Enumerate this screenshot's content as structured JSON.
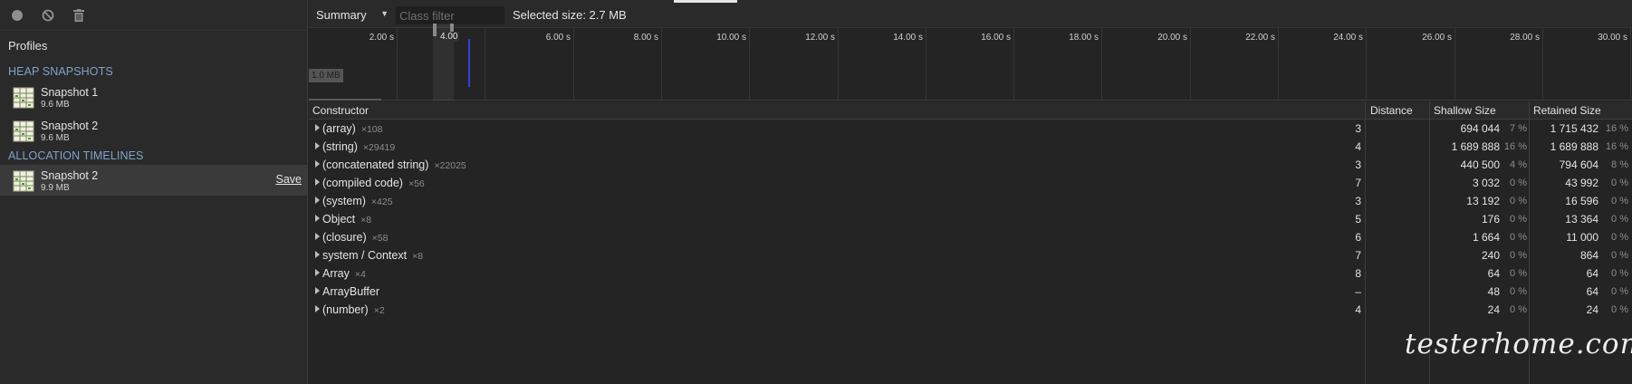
{
  "sidebar": {
    "toolbar": [
      {
        "icon": "record-icon"
      },
      {
        "icon": "clear-icon"
      },
      {
        "icon": "trash-icon"
      }
    ],
    "profiles_title": "Profiles",
    "heap_section_title": "HEAP SNAPSHOTS",
    "heap_snapshots": [
      {
        "name": "Snapshot 1",
        "size": "9.6 MB"
      },
      {
        "name": "Snapshot 2",
        "size": "9.6 MB"
      }
    ],
    "alloc_section_title": "ALLOCATION TIMELINES",
    "alloc_timelines": [
      {
        "name": "Snapshot 2",
        "size": "9.9 MB",
        "save_label": "Save",
        "selected": true
      }
    ]
  },
  "topbar": {
    "view": "Summary",
    "filter_placeholder": "Class filter",
    "filter_value": "",
    "selected_size": "Selected size: 2.7 MB"
  },
  "timeline": {
    "ticks": [
      "2.00 s",
      "4.00 s",
      "6.00 s",
      "8.00 s",
      "10.00 s",
      "12.00 s",
      "14.00 s",
      "16.00 s",
      "18.00 s",
      "20.00 s",
      "22.00 s",
      "24.00 s",
      "26.00 s",
      "28.00 s",
      "30.00 s"
    ],
    "memory_label": "1.0 MB",
    "window_label": "4.00"
  },
  "grid": {
    "headers": {
      "constructor": "Constructor",
      "distance": "Distance",
      "shallow": "Shallow Size",
      "retained": "Retained Size"
    },
    "rows": [
      {
        "name": "(array)",
        "count": "×108",
        "distance": "3",
        "shallow": "694 044",
        "shallow_pct": "7 %",
        "retained": "1 715 432",
        "retained_pct": "16 %"
      },
      {
        "name": "(string)",
        "count": "×29419",
        "distance": "4",
        "shallow": "1 689 888",
        "shallow_pct": "16 %",
        "retained": "1 689 888",
        "retained_pct": "16 %"
      },
      {
        "name": "(concatenated string)",
        "count": "×22025",
        "distance": "3",
        "shallow": "440 500",
        "shallow_pct": "4 %",
        "retained": "794 604",
        "retained_pct": "8 %"
      },
      {
        "name": "(compiled code)",
        "count": "×56",
        "distance": "7",
        "shallow": "3 032",
        "shallow_pct": "0 %",
        "retained": "43 992",
        "retained_pct": "0 %"
      },
      {
        "name": "(system)",
        "count": "×425",
        "distance": "3",
        "shallow": "13 192",
        "shallow_pct": "0 %",
        "retained": "16 596",
        "retained_pct": "0 %"
      },
      {
        "name": "Object",
        "count": "×8",
        "distance": "5",
        "shallow": "176",
        "shallow_pct": "0 %",
        "retained": "13 364",
        "retained_pct": "0 %"
      },
      {
        "name": "(closure)",
        "count": "×58",
        "distance": "6",
        "shallow": "1 664",
        "shallow_pct": "0 %",
        "retained": "11 000",
        "retained_pct": "0 %"
      },
      {
        "name": "system / Context",
        "count": "×8",
        "distance": "7",
        "shallow": "240",
        "shallow_pct": "0 %",
        "retained": "864",
        "retained_pct": "0 %"
      },
      {
        "name": "Array",
        "count": "×4",
        "distance": "8",
        "shallow": "64",
        "shallow_pct": "0 %",
        "retained": "64",
        "retained_pct": "0 %"
      },
      {
        "name": "ArrayBuffer",
        "count": "",
        "distance": "–",
        "shallow": "48",
        "shallow_pct": "0 %",
        "retained": "64",
        "retained_pct": "0 %"
      },
      {
        "name": "(number)",
        "count": "×2",
        "distance": "4",
        "shallow": "24",
        "shallow_pct": "0 %",
        "retained": "24",
        "retained_pct": "0 %"
      }
    ]
  },
  "watermark": "testerhome.com"
}
